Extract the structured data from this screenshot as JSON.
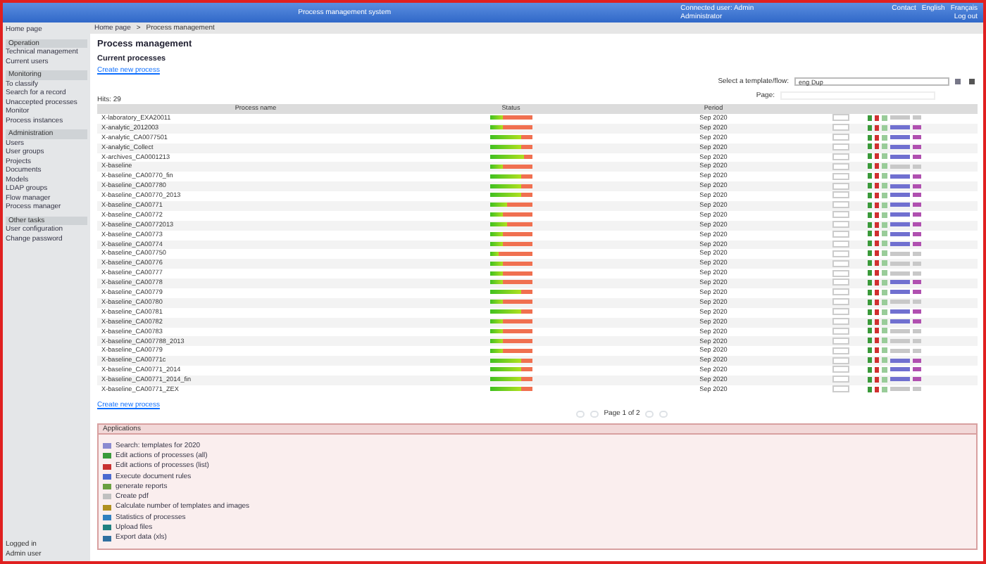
{
  "header": {
    "title": "Process management system",
    "user": "Connected user: Admin",
    "user_role": "Administrator",
    "links": [
      "Contact",
      "English",
      "Français"
    ],
    "logout": "Log out"
  },
  "sidebar": {
    "home": "Home page",
    "sections": [
      {
        "title": "Operation",
        "items": [
          "Technical management",
          "Current users"
        ]
      },
      {
        "title": "Monitoring",
        "items": [
          "To classify",
          "Search for a record",
          "Unaccepted processes",
          "Monitor",
          "Process instances"
        ]
      },
      {
        "title": "Administration",
        "items": [
          "Users",
          "User groups",
          "Projects",
          "Documents",
          "Models",
          "LDAP groups",
          "Flow manager",
          "Process manager"
        ]
      },
      {
        "title": "Other tasks",
        "items": [
          "User configuration",
          "Change password"
        ]
      }
    ],
    "footer": [
      "Logged in",
      "Admin user"
    ]
  },
  "breadcrumb": [
    "Home page",
    "Process management"
  ],
  "breadcrumb_separator": ">",
  "page_title": "Process management",
  "section_title": "Current processes",
  "create_link_top": "Create new process",
  "filter": {
    "label": "Select a template/flow:",
    "value": "eng Dup"
  },
  "page_label": "Page:",
  "hits": "Hits: 29",
  "table": {
    "columns": [
      "Process name",
      "Status",
      "Period"
    ],
    "rows": [
      {
        "name": "X-laboratory_EXA20011",
        "level": 0.3,
        "period": "Sep 2020",
        "links": false
      },
      {
        "name": "X-analytic_2012003",
        "level": 0.3,
        "period": "Sep 2020",
        "links": true
      },
      {
        "name": "X-analytic_CA0077501",
        "level": 0.75,
        "period": "Sep 2020",
        "links": true
      },
      {
        "name": "X-analytic_Collect",
        "level": 0.75,
        "period": "Sep 2020",
        "links": true
      },
      {
        "name": "X-archives_CA0001213",
        "level": 0.8,
        "period": "Sep 2020",
        "links": true
      },
      {
        "name": "X-baseline",
        "level": 0.3,
        "period": "Sep 2020",
        "links": false
      },
      {
        "name": "X-baseline_CA00770_fin",
        "level": 0.75,
        "period": "Sep 2020",
        "links": true
      },
      {
        "name": "X-baseline_CA007780",
        "level": 0.75,
        "period": "Sep 2020",
        "links": true
      },
      {
        "name": "X-baseline_CA00770_2013",
        "level": 0.75,
        "period": "Sep 2020",
        "links": true
      },
      {
        "name": "X-baseline_CA00771",
        "level": 0.4,
        "period": "Sep 2020",
        "links": true
      },
      {
        "name": "X-baseline_CA00772",
        "level": 0.3,
        "period": "Sep 2020",
        "links": true
      },
      {
        "name": "X-baseline_CA00772013",
        "level": 0.4,
        "period": "Sep 2020",
        "links": true
      },
      {
        "name": "X-baseline_CA00773",
        "level": 0.3,
        "period": "Sep 2020",
        "links": true
      },
      {
        "name": "X-baseline_CA00774",
        "level": 0.3,
        "period": "Sep 2020",
        "links": true
      },
      {
        "name": "X-baseline_CA007750",
        "level": 0.2,
        "period": "Sep 2020",
        "links": false
      },
      {
        "name": "X-baseline_CA00776",
        "level": 0.3,
        "period": "Sep 2020",
        "links": false
      },
      {
        "name": "X-baseline_CA00777",
        "level": 0.3,
        "period": "Sep 2020",
        "links": false
      },
      {
        "name": "X-baseline_CA00778",
        "level": 0.3,
        "period": "Sep 2020",
        "links": true
      },
      {
        "name": "X-baseline_CA00779",
        "level": 0.75,
        "period": "Sep 2020",
        "links": true
      },
      {
        "name": "X-baseline_CA00780",
        "level": 0.3,
        "period": "Sep 2020",
        "links": false
      },
      {
        "name": "X-baseline_CA00781",
        "level": 0.75,
        "period": "Sep 2020",
        "links": true
      },
      {
        "name": "X-baseline_CA00782",
        "level": 0.3,
        "period": "Sep 2020",
        "links": true
      },
      {
        "name": "X-baseline_CA00783",
        "level": 0.3,
        "period": "Sep 2020",
        "links": false
      },
      {
        "name": "X-baseline_CA007788_2013",
        "level": 0.3,
        "period": "Sep 2020",
        "links": false
      },
      {
        "name": "X-baseline_CA00779",
        "level": 0.3,
        "period": "Sep 2020",
        "links": false
      },
      {
        "name": "X-baseline_CA00771c",
        "level": 0.75,
        "period": "Sep 2020",
        "links": true
      },
      {
        "name": "X-baseline_CA00771_2014",
        "level": 0.75,
        "period": "Sep 2020",
        "links": true
      },
      {
        "name": "X-baseline_CA00771_2014_fin",
        "level": 0.75,
        "period": "Sep 2020",
        "links": true
      },
      {
        "name": "X-baseline_CA00771_ZEX",
        "level": 0.75,
        "period": "Sep 2020",
        "links": false
      }
    ]
  },
  "create_link": "Create new process",
  "pagination": "Page 1 of 2",
  "applications": {
    "title": "Applications",
    "items": [
      {
        "label": "Search: templates for 2020",
        "color": "#8a8ad0"
      },
      {
        "label": "Edit actions of processes (all)",
        "color": "#3a9a3a"
      },
      {
        "label": "Edit actions of processes (list)",
        "color": "#c83030"
      },
      {
        "label": "Execute document rules",
        "color": "#4a6ad0"
      },
      {
        "label": "generate reports",
        "color": "#6aa040"
      },
      {
        "label": "Create pdf",
        "color": "#c0c0c0"
      },
      {
        "label": "Calculate number of templates and images",
        "color": "#b09020"
      },
      {
        "label": "Statistics of processes",
        "color": "#3080c0"
      },
      {
        "label": "Upload files",
        "color": "#208080"
      },
      {
        "label": "Export data (xls)",
        "color": "#3070a0"
      }
    ]
  }
}
